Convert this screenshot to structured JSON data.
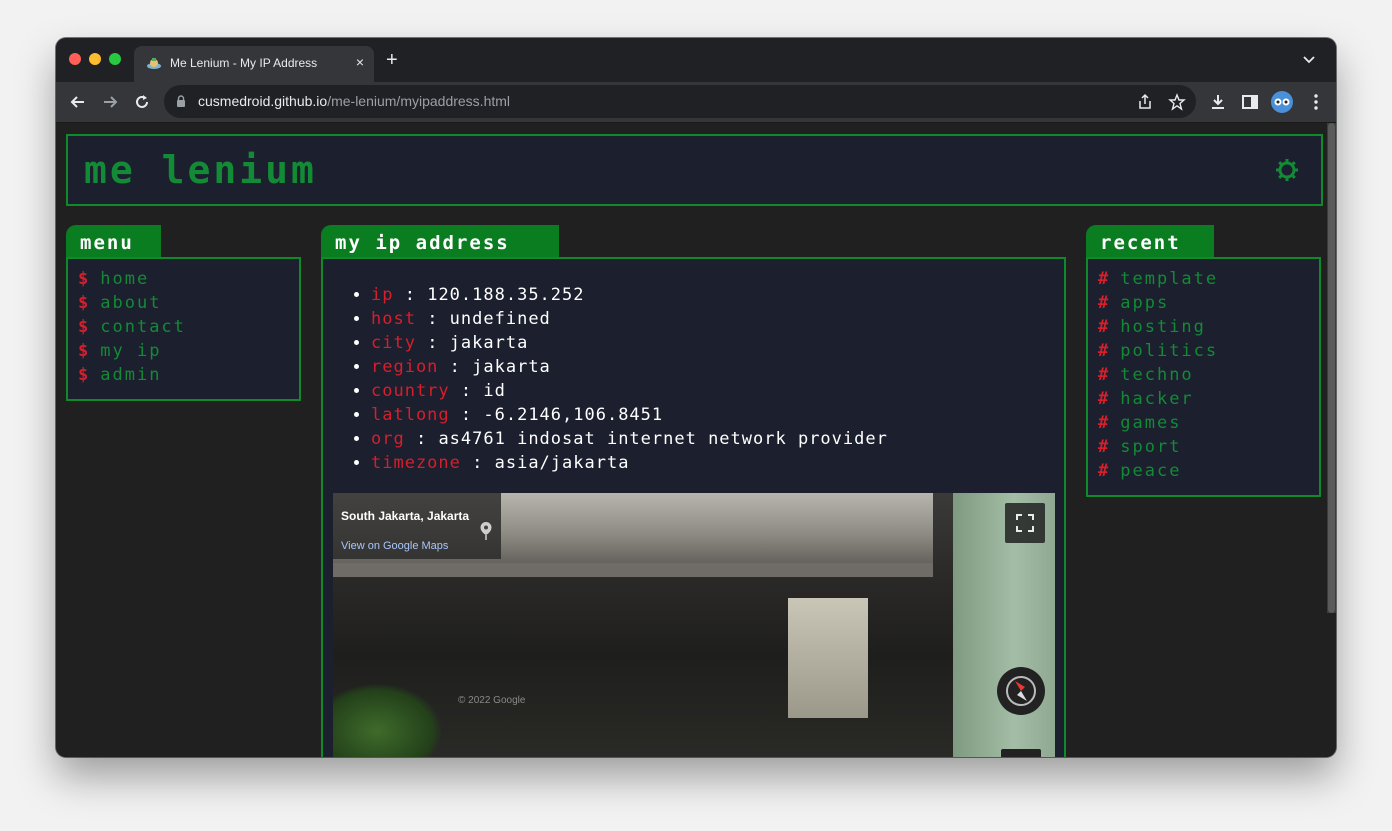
{
  "browser": {
    "tab_title": "Me Lenium - My IP Address",
    "tab_close": "×",
    "new_tab": "+",
    "url_host": "cusmedroid.github.io",
    "url_path": "/me-lenium/myipaddress.html"
  },
  "site": {
    "title": "Me Lenium"
  },
  "menu": {
    "heading": "Menu",
    "bullet": "$",
    "items": [
      "Home",
      "About",
      "Contact",
      "My IP",
      "Admin"
    ]
  },
  "main": {
    "heading": "My IP Address",
    "info": [
      {
        "key": "IP",
        "value": "120.188.35.252"
      },
      {
        "key": "Host",
        "value": "undefined"
      },
      {
        "key": "City",
        "value": "Jakarta"
      },
      {
        "key": "Region",
        "value": "Jakarta"
      },
      {
        "key": "Country",
        "value": "ID"
      },
      {
        "key": "LatLong",
        "value": "-6.2146,106.8451"
      },
      {
        "key": "Org",
        "value": "AS4761 INDOSAT Internet Network Provider"
      },
      {
        "key": "Timezone",
        "value": "Asia/Jakarta"
      }
    ],
    "separator": " : ",
    "map": {
      "place": "South Jakarta, Jakarta",
      "link": "View on Google Maps",
      "copyright": "© 2022 Google"
    }
  },
  "recent": {
    "heading": "Recent",
    "bullet": "#",
    "items": [
      "Template",
      "Apps",
      "Hosting",
      "Politics",
      "Techno",
      "Hacker",
      "Games",
      "Sport",
      "Peace"
    ]
  },
  "colors": {
    "accent_green": "#0f8a2b",
    "link_green": "#138a35",
    "key_red": "#d71f2c",
    "panel_bg": "#1b1f2e",
    "page_bg": "#202020"
  },
  "icons": {
    "gear": "gear-icon",
    "back": "back-arrow-icon",
    "forward": "forward-arrow-icon",
    "reload": "reload-icon",
    "lock": "lock-icon",
    "share": "share-icon",
    "star": "star-icon",
    "download": "download-icon",
    "sidepanel": "side-panel-icon",
    "profile": "profile-avatar-icon",
    "kebab": "more-vert-icon"
  }
}
